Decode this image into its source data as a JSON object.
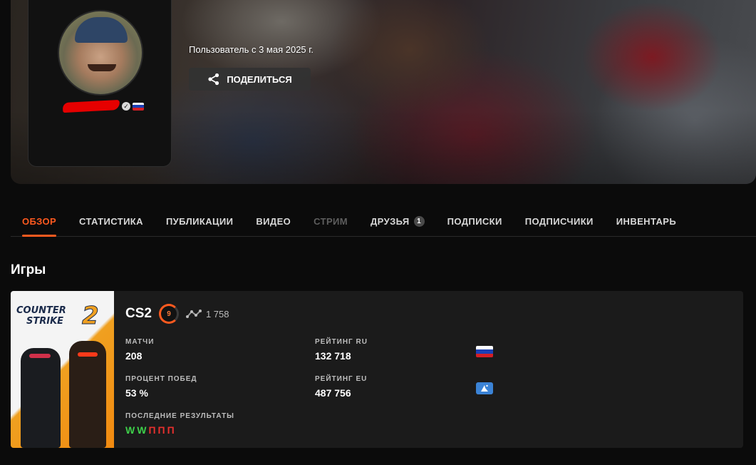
{
  "banner": {
    "member_since": "Пользователь с 3 мая 2025 г.",
    "share_label": "ПОДЕЛИТЬСЯ"
  },
  "profile": {
    "avatar_icon": "avatar-photo",
    "verified_icon": "verified-check-icon",
    "country_flag": "flag-ru-icon"
  },
  "tabs": [
    {
      "label": "ОБЗОР",
      "state": "active"
    },
    {
      "label": "СТАТИСТИКА",
      "state": "normal"
    },
    {
      "label": "ПУБЛИКАЦИИ",
      "state": "normal"
    },
    {
      "label": "ВИДЕО",
      "state": "normal"
    },
    {
      "label": "СТРИМ",
      "state": "disabled"
    },
    {
      "label": "ДРУЗЬЯ",
      "state": "normal",
      "badge": "1"
    },
    {
      "label": "ПОДПИСКИ",
      "state": "normal"
    },
    {
      "label": "ПОДПИСЧИКИ",
      "state": "normal"
    },
    {
      "label": "ИНВЕНТАРЬ",
      "state": "normal"
    }
  ],
  "games": {
    "title": "Игры",
    "items": [
      {
        "cover_logo_line1": "COUNTER",
        "cover_logo_line2": "STRIKE",
        "cover_logo_number": "2",
        "name": "CS2",
        "level": "9",
        "elo": "1 758",
        "stats": {
          "matches_label": "МАТЧИ",
          "matches_value": "208",
          "winrate_label": "ПРОЦЕНТ ПОБЕД",
          "winrate_value": "53 %",
          "recent_label": "ПОСЛЕДНИЕ РЕЗУЛЬТАТЫ",
          "recent_results": [
            "W",
            "W",
            "П",
            "П",
            "П"
          ],
          "rating_ru_label": "РЕЙТИНГ RU",
          "rating_ru_value": "132 718",
          "rating_eu_label": "РЕЙТИНГ EU",
          "rating_eu_value": "487 756"
        }
      }
    ]
  },
  "colors": {
    "accent": "#ff5a1f",
    "background": "#0b0b0b",
    "card": "#1b1b1b",
    "win": "#3ecf4a",
    "loss": "#e8302e"
  }
}
